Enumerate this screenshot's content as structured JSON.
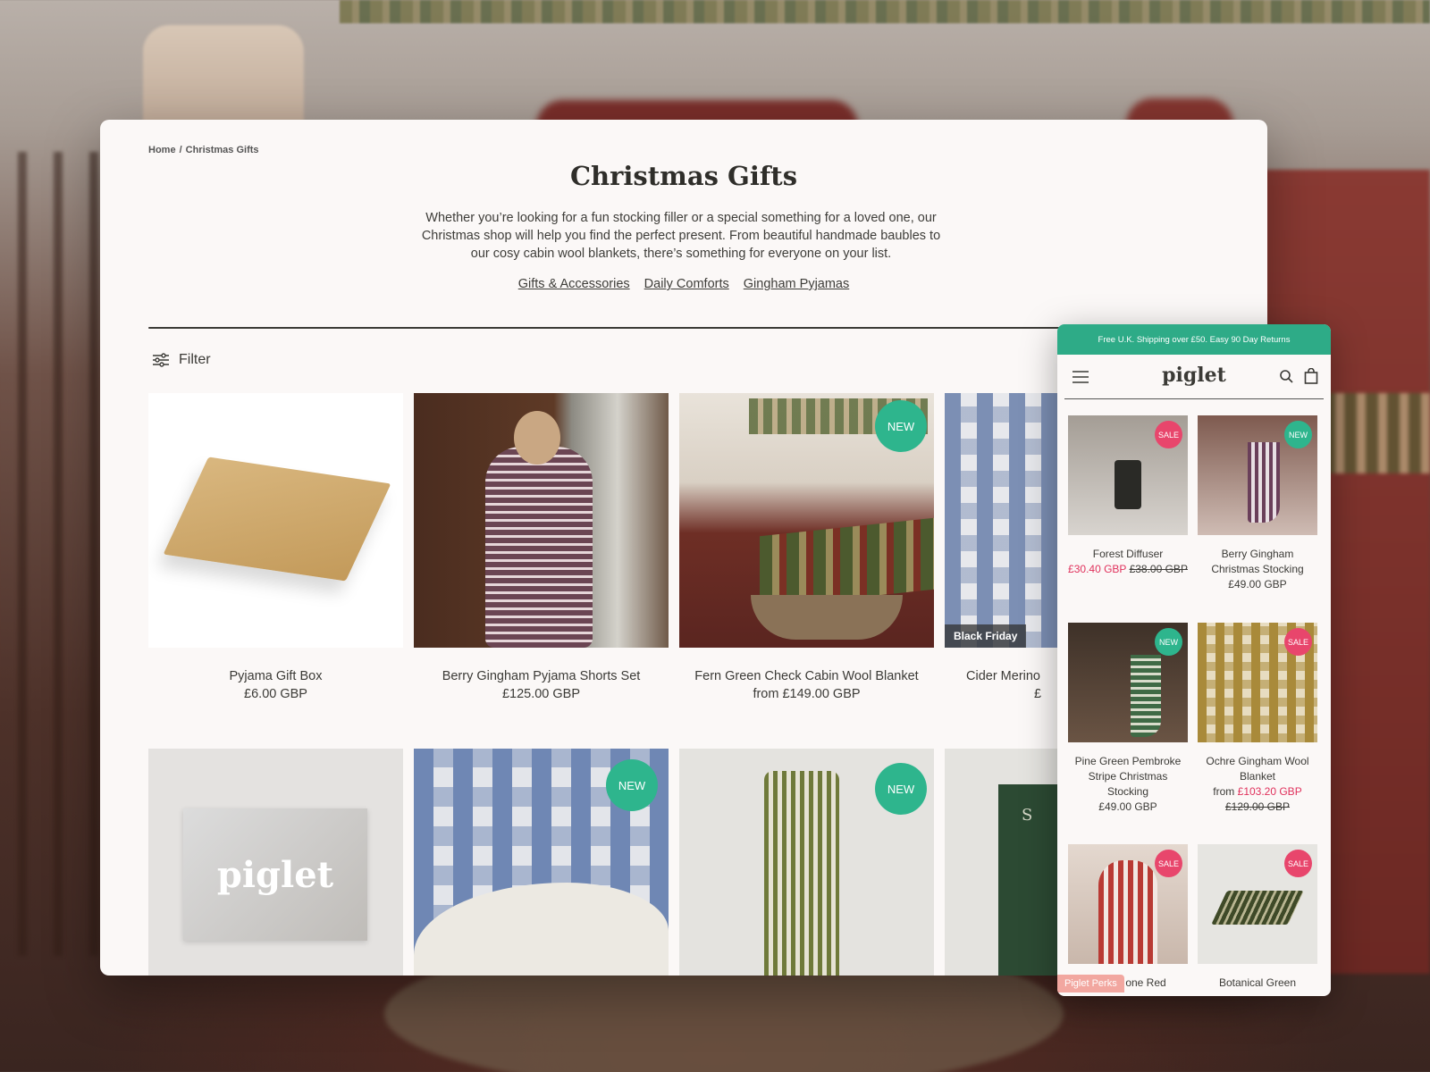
{
  "breadcrumb": {
    "home": "Home",
    "separator": "/",
    "current": "Christmas Gifts"
  },
  "page": {
    "title": "Christmas Gifts",
    "description": "Whether you’re looking for a fun stocking filler or a special something for a loved one, our Christmas shop will help you find the perfect present. From beautiful handmade baubles to our cosy cabin wool blankets, there’s something for everyone on your list.",
    "links": [
      "Gifts & Accessories",
      "Daily Comforts",
      "Gingham Pyjamas"
    ]
  },
  "filter": {
    "label": "Filter",
    "icon": "sliders-icon"
  },
  "products": [
    {
      "name": "Pyjama Gift Box",
      "price": "£6.00 GBP",
      "badge": ""
    },
    {
      "name": "Berry Gingham Pyjama Shorts Set",
      "price": "£125.00 GBP",
      "badge": ""
    },
    {
      "name": "Fern Green Check Cabin Wool Blanket",
      "price": "from £149.00 GBP",
      "badge": "NEW"
    },
    {
      "name": "Cider Merino",
      "price": "£",
      "badge": "Black Friday"
    },
    {
      "name": "",
      "price": "",
      "badge": "",
      "image_text": "piglet"
    },
    {
      "name": "",
      "price": "",
      "badge": "NEW"
    },
    {
      "name": "",
      "price": "",
      "badge": "NEW"
    },
    {
      "name": "",
      "price": "",
      "badge": "",
      "image_text": "S"
    }
  ],
  "mobile": {
    "shipping_bar": "Free U.K. Shipping over £50. Easy 90 Day Returns",
    "logo": "piglet",
    "products": [
      {
        "name": "Forest Diffuser",
        "sale_price": "£30.40 GBP",
        "was_price": "£38.00 GBP",
        "price": "",
        "badge": "SALE"
      },
      {
        "name": "Berry Gingham Christmas Stocking",
        "price": "£49.00 GBP",
        "badge": "NEW"
      },
      {
        "name": "Pine Green Pembroke Stripe Christmas Stocking",
        "price": "£49.00 GBP",
        "badge": "NEW"
      },
      {
        "name": "Ochre Gingham Wool Blanket",
        "price_prefix": "from",
        "sale_price": "£103.20 GBP",
        "was_price": "£129.00 GBP",
        "badge": "SALE"
      },
      {
        "name": "one Red",
        "price": "",
        "badge": "SALE"
      },
      {
        "name": "Botanical Green",
        "price": "",
        "badge": "SALE"
      }
    ],
    "perks": "Piglet Perks"
  },
  "colors": {
    "accent_green": "#2eb58d",
    "sale_pink": "#e8466c",
    "sale_text": "#e0315c"
  }
}
